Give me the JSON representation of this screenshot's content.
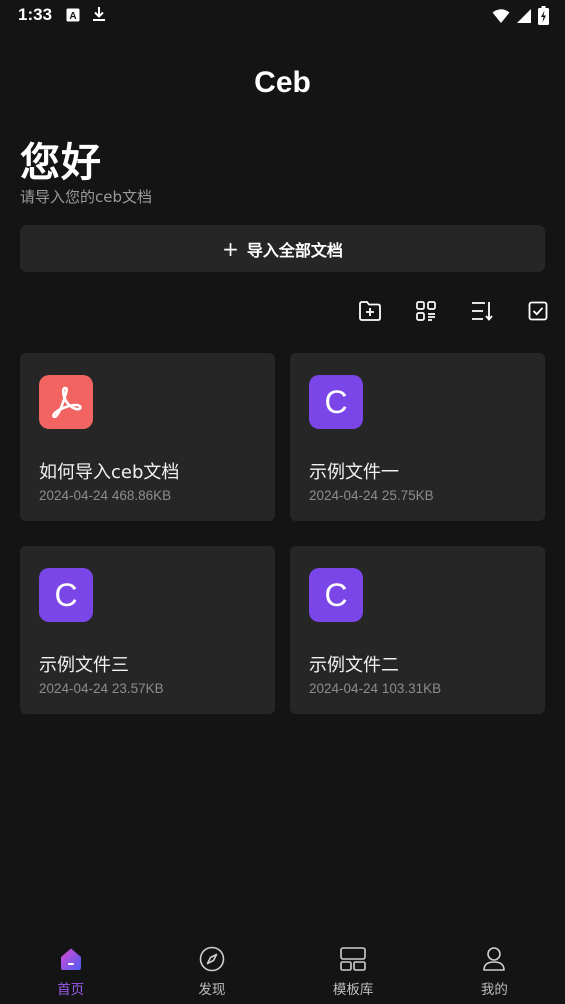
{
  "status_bar": {
    "time": "1:33",
    "left_icons": [
      "font-a-icon",
      "download-icon"
    ],
    "right_icons": [
      "wifi-icon",
      "signal-icon",
      "battery-charging-icon"
    ]
  },
  "header": {
    "title": "Ceb",
    "greeting": "您好",
    "subtitle": "请导入您的ceb文档"
  },
  "import_button": {
    "icon": "plus-icon",
    "label": "导入全部文档"
  },
  "toolbar": {
    "icons": [
      "new-folder-icon",
      "grid-view-icon",
      "sort-icon",
      "select-checkbox-icon"
    ]
  },
  "files": [
    {
      "title": "如何导入ceb文档",
      "date": "2024-04-24",
      "size": "468.86KB",
      "icon": "pdf-icon",
      "badge": ""
    },
    {
      "title": "示例文件一",
      "date": "2024-04-24",
      "size": "25.75KB",
      "icon": "ceb-file-icon",
      "badge": "C"
    },
    {
      "title": "示例文件三",
      "date": "2024-04-24",
      "size": "23.57KB",
      "icon": "ceb-file-icon",
      "badge": "C"
    },
    {
      "title": "示例文件二",
      "date": "2024-04-24",
      "size": "103.31KB",
      "icon": "ceb-file-icon",
      "badge": "C"
    }
  ],
  "bottom_nav": {
    "active": "home",
    "items": [
      {
        "key": "home",
        "label": "首页",
        "icon": "home-icon"
      },
      {
        "key": "discover",
        "label": "发现",
        "icon": "compass-icon"
      },
      {
        "key": "templates",
        "label": "模板库",
        "icon": "template-icon"
      },
      {
        "key": "mine",
        "label": "我的",
        "icon": "user-icon"
      }
    ]
  },
  "colors": {
    "background": "#141414",
    "card": "#262626",
    "accent": "#9c5cf0",
    "pdf": "#f16462",
    "ceb": "#7b46e8"
  }
}
